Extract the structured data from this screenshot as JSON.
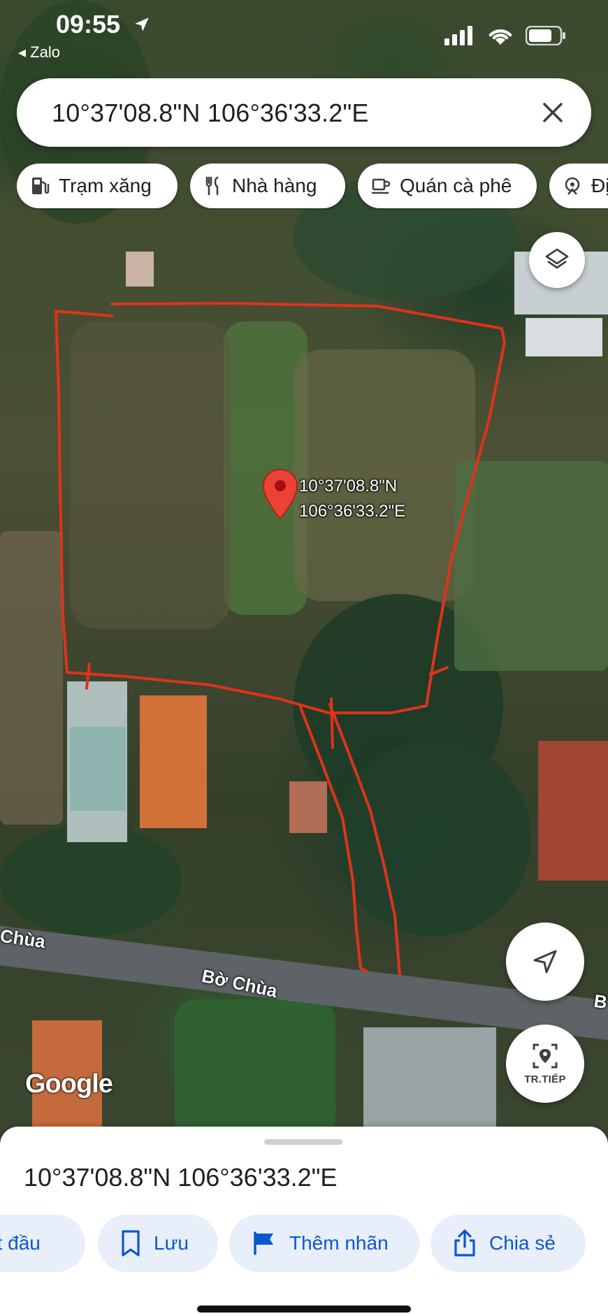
{
  "status_bar": {
    "time": "09:55",
    "back_app": "Zalo"
  },
  "search": {
    "query": "10°37'08.8\"N 106°36'33.2\"E"
  },
  "chips": [
    {
      "label": "Trạm xăng",
      "icon": "gas-station-icon"
    },
    {
      "label": "Nhà hàng",
      "icon": "restaurant-icon"
    },
    {
      "label": "Quán cà phê",
      "icon": "cafe-icon"
    },
    {
      "label": "Đị",
      "icon": "attraction-icon"
    }
  ],
  "map": {
    "pin_label_line1": "10°37'08.8\"N",
    "pin_label_line2": "106°36'33.2\"E",
    "road_labels": [
      "Chùa",
      "Bờ Chùa",
      "B"
    ],
    "attribution": "Google",
    "boundary_color": "#e0321c",
    "pin_color": "#ea4335"
  },
  "live_button": {
    "label": "TR.TIẾP"
  },
  "sheet": {
    "title": "10°37'08.8\"N 106°36'33.2\"E",
    "actions": [
      {
        "label": "ắt đầu",
        "icon": "directions-icon"
      },
      {
        "label": "Lưu",
        "icon": "bookmark-icon"
      },
      {
        "label": "Thêm nhãn",
        "icon": "flag-icon"
      },
      {
        "label": "Chia sẻ",
        "icon": "share-icon"
      }
    ],
    "accent_color": "#0b57d0"
  }
}
